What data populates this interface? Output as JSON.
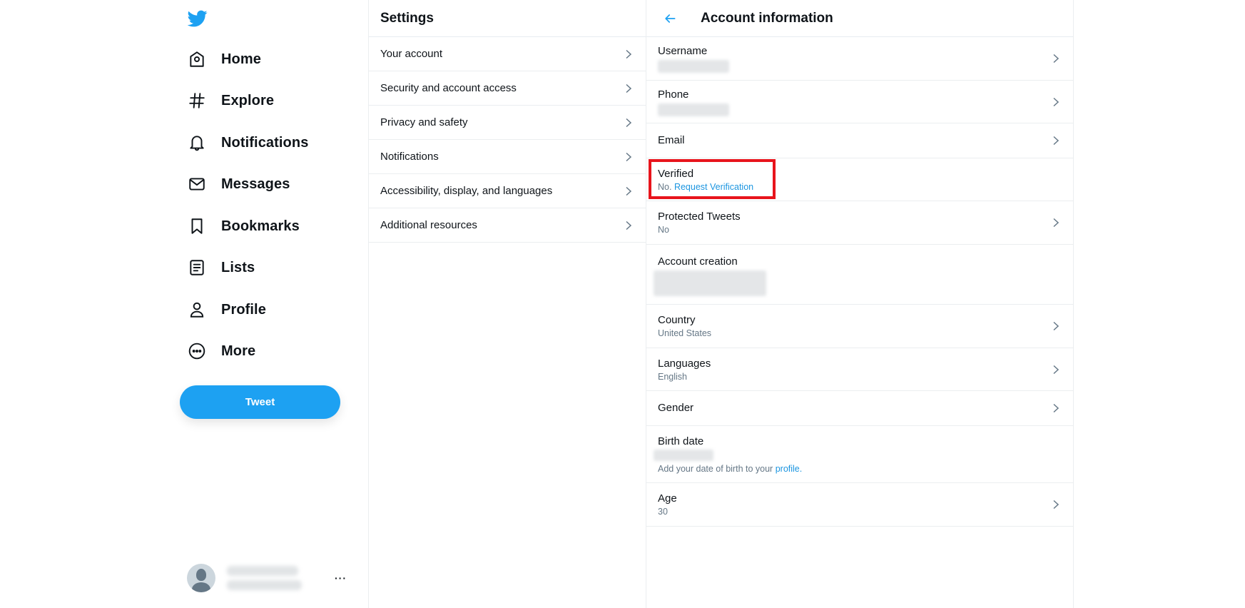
{
  "sidebar": {
    "logo": "twitter-bird-logo",
    "nav": [
      {
        "label": "Home",
        "icon": "home-icon"
      },
      {
        "label": "Explore",
        "icon": "hashtag-icon"
      },
      {
        "label": "Notifications",
        "icon": "bell-icon"
      },
      {
        "label": "Messages",
        "icon": "envelope-icon"
      },
      {
        "label": "Bookmarks",
        "icon": "bookmark-icon"
      },
      {
        "label": "Lists",
        "icon": "list-icon"
      },
      {
        "label": "Profile",
        "icon": "person-icon"
      },
      {
        "label": "More",
        "icon": "more-circle-icon"
      }
    ],
    "tweet_button": "Tweet",
    "account_more": "···"
  },
  "settings": {
    "title": "Settings",
    "items": [
      {
        "label": "Your account"
      },
      {
        "label": "Security and account access"
      },
      {
        "label": "Privacy and safety"
      },
      {
        "label": "Notifications"
      },
      {
        "label": "Accessibility, display, and languages"
      },
      {
        "label": "Additional resources"
      }
    ]
  },
  "account_info": {
    "title": "Account information",
    "rows": {
      "username": {
        "label": "Username"
      },
      "phone": {
        "label": "Phone"
      },
      "email": {
        "label": "Email"
      },
      "verified": {
        "label": "Verified",
        "value_prefix": "No.",
        "link": "Request Verification"
      },
      "protected": {
        "label": "Protected Tweets",
        "value": "No"
      },
      "creation": {
        "label": "Account creation"
      },
      "country": {
        "label": "Country",
        "value": "United States"
      },
      "languages": {
        "label": "Languages",
        "value": "English"
      },
      "gender": {
        "label": "Gender"
      },
      "birth": {
        "label": "Birth date",
        "note_prefix": "Add your date of birth to your",
        "note_link": "profile",
        "note_suffix": "."
      },
      "age": {
        "label": "Age",
        "value": "30"
      }
    }
  },
  "colors": {
    "brand": "#1da1f2",
    "link": "#1b95e0",
    "highlight_box": "#e8141c"
  }
}
